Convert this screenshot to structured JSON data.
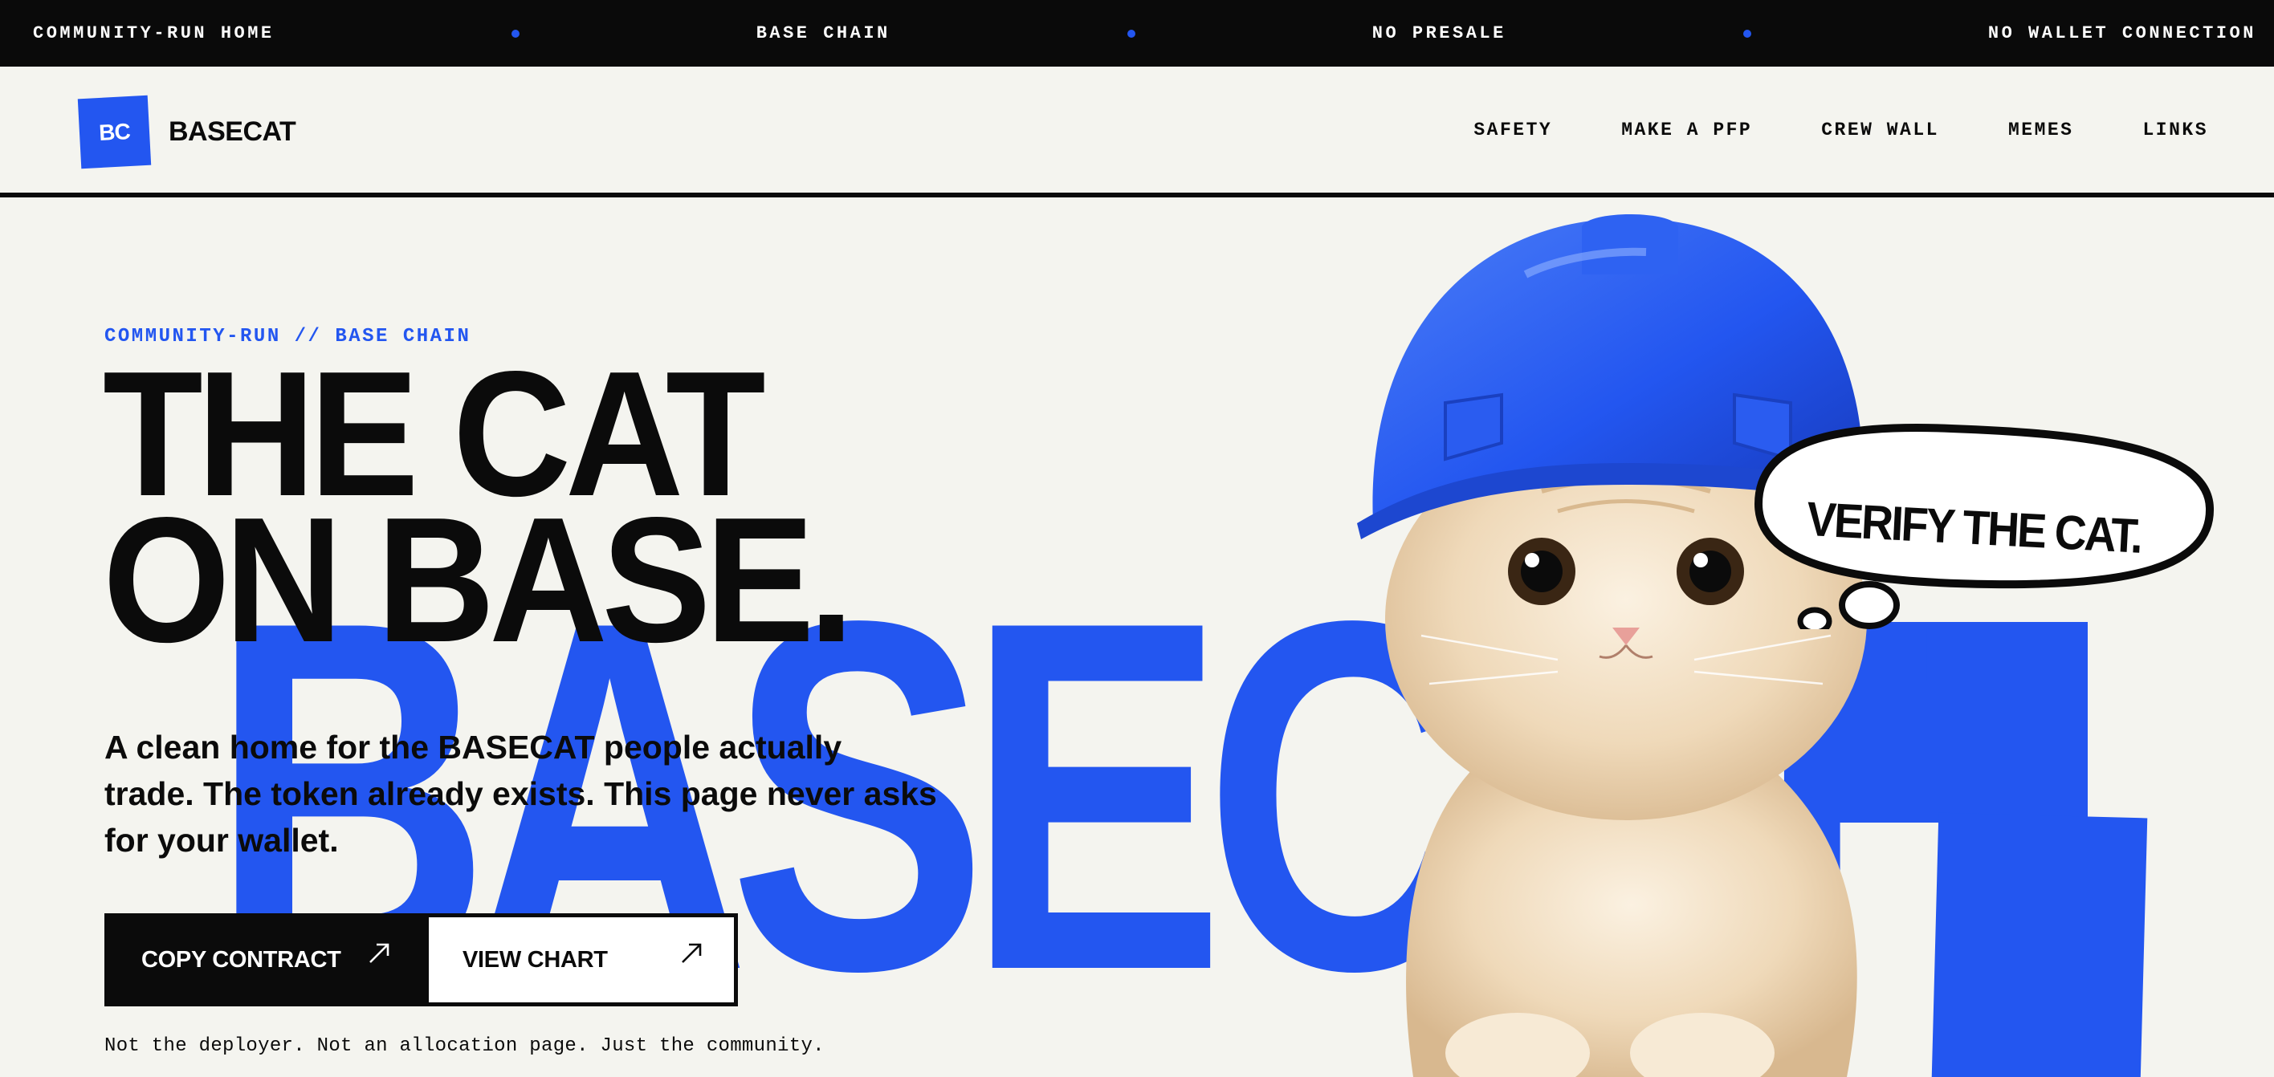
{
  "ticker": {
    "items": [
      "COMMUNITY-RUN HOME",
      "BASE CHAIN",
      "NO PRESALE",
      "NO WALLET CONNECTION"
    ]
  },
  "nav": {
    "logo_mark": "BC",
    "logo_text": "BASECAT",
    "links": [
      "SAFETY",
      "MAKE A PFP",
      "CREW WALL",
      "MEMES",
      "LINKS"
    ]
  },
  "hero": {
    "eyebrow": "COMMUNITY-RUN // BASE CHAIN",
    "headline": [
      "THE CAT",
      "ON BASE."
    ],
    "background_word": "BASECAT",
    "subtitle": "A clean home for the BASECAT people actually trade. The token already exists. This page never asks for your wallet.",
    "buttons": {
      "copy_contract": "COPY CONTRACT",
      "view_chart": "VIEW CHART"
    },
    "note": "Not the deployer. Not an allocation page. Just the community.",
    "speech_bubble": "VERIFY THE CAT."
  },
  "colors": {
    "accent": "#2356f0",
    "ink": "#0b0b0b",
    "paper": "#f4f4ef"
  }
}
